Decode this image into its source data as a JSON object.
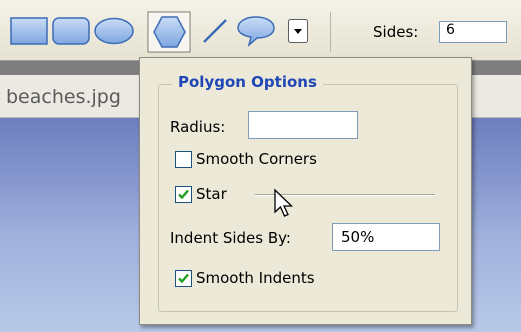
{
  "toolbar": {
    "tools": [
      {
        "name": "rectangle-tool-icon"
      },
      {
        "name": "rounded-rectangle-tool-icon"
      },
      {
        "name": "ellipse-tool-icon"
      },
      {
        "name": "polygon-tool-icon",
        "selected": true
      },
      {
        "name": "line-tool-icon"
      },
      {
        "name": "custom-shape-tool-icon"
      }
    ],
    "dropdown_icon": "chevron-down-icon",
    "sides_label": "Sides:",
    "sides_value": "6"
  },
  "document": {
    "tab_label": "beaches.jpg"
  },
  "polygon_options": {
    "title": "Polygon Options",
    "radius_label": "Radius:",
    "radius_value": "",
    "smooth_corners_label": "Smooth Corners",
    "smooth_corners_checked": false,
    "star_label": "Star",
    "star_checked": true,
    "indent_label": "Indent Sides By:",
    "indent_value": "50%",
    "smooth_indents_label": "Smooth Indents",
    "smooth_indents_checked": true
  },
  "colors": {
    "accent_title": "#2146b5",
    "shape_fill": "#8fb3e8",
    "shape_stroke": "#3d6bb5"
  }
}
